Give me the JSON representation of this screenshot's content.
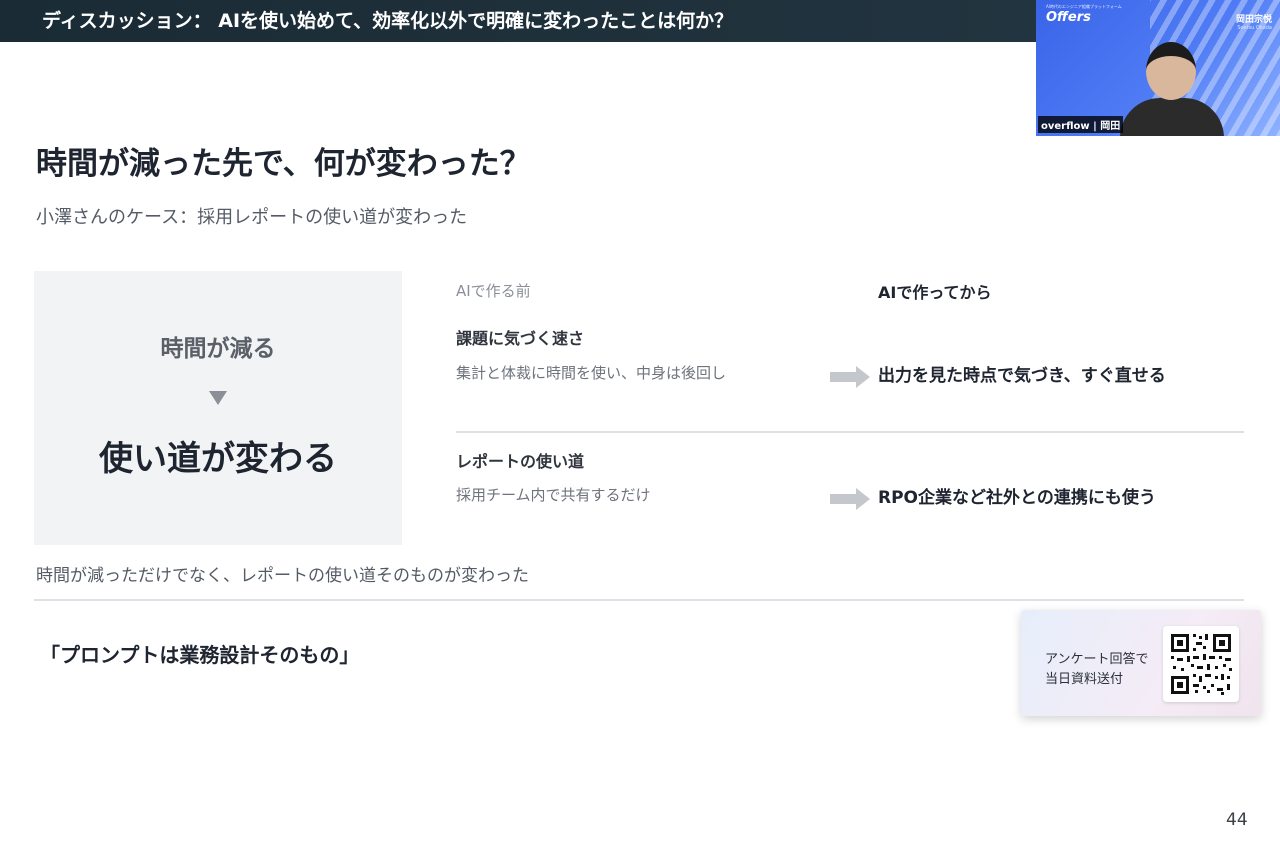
{
  "header": {
    "title": "ディスカッション： AIを使い始めて、効率化以外で明確に変わったことは何か？"
  },
  "webcam": {
    "brand": "Offers",
    "brand_tagline": "AI時代のエンジニア組織プラットフォーム",
    "speaker_name": "岡田宗悦",
    "speaker_roman": "Soetsu Okada",
    "label": "overflow | 岡田"
  },
  "slide": {
    "title": "時間が減った先で、何が変わった？",
    "subtitle": "小澤さんのケース：採用レポートの使い道が変わった",
    "left_box": {
      "top_text": "時間が減る",
      "bottom_text": "使い道が変わる"
    },
    "columns": {
      "before": "AIで作る前",
      "after": "AIで作ってから"
    },
    "rows": [
      {
        "label": "課題に気づく速さ",
        "before": "集計と体裁に時間を使い、中身は後回し",
        "after": "出力を見た時点で気づき、すぐ直せる"
      },
      {
        "label": "レポートの使い道",
        "before": "採用チーム内で共有するだけ",
        "after": "RPO企業など社外との連携にも使う"
      }
    ],
    "note": "時間が減っただけでなく、レポートの使い道そのものが変わった",
    "quote": "「プロンプトは業務設計そのもの」",
    "page_number": "44"
  },
  "survey": {
    "line1": "アンケート回答で",
    "line2": "当日資料送付"
  },
  "colors": {
    "header_bg": "#1a2b35",
    "webcam_bg": "#3a64e8",
    "left_box_bg": "#f1f3f5",
    "arrow": "#c4c7cc"
  }
}
